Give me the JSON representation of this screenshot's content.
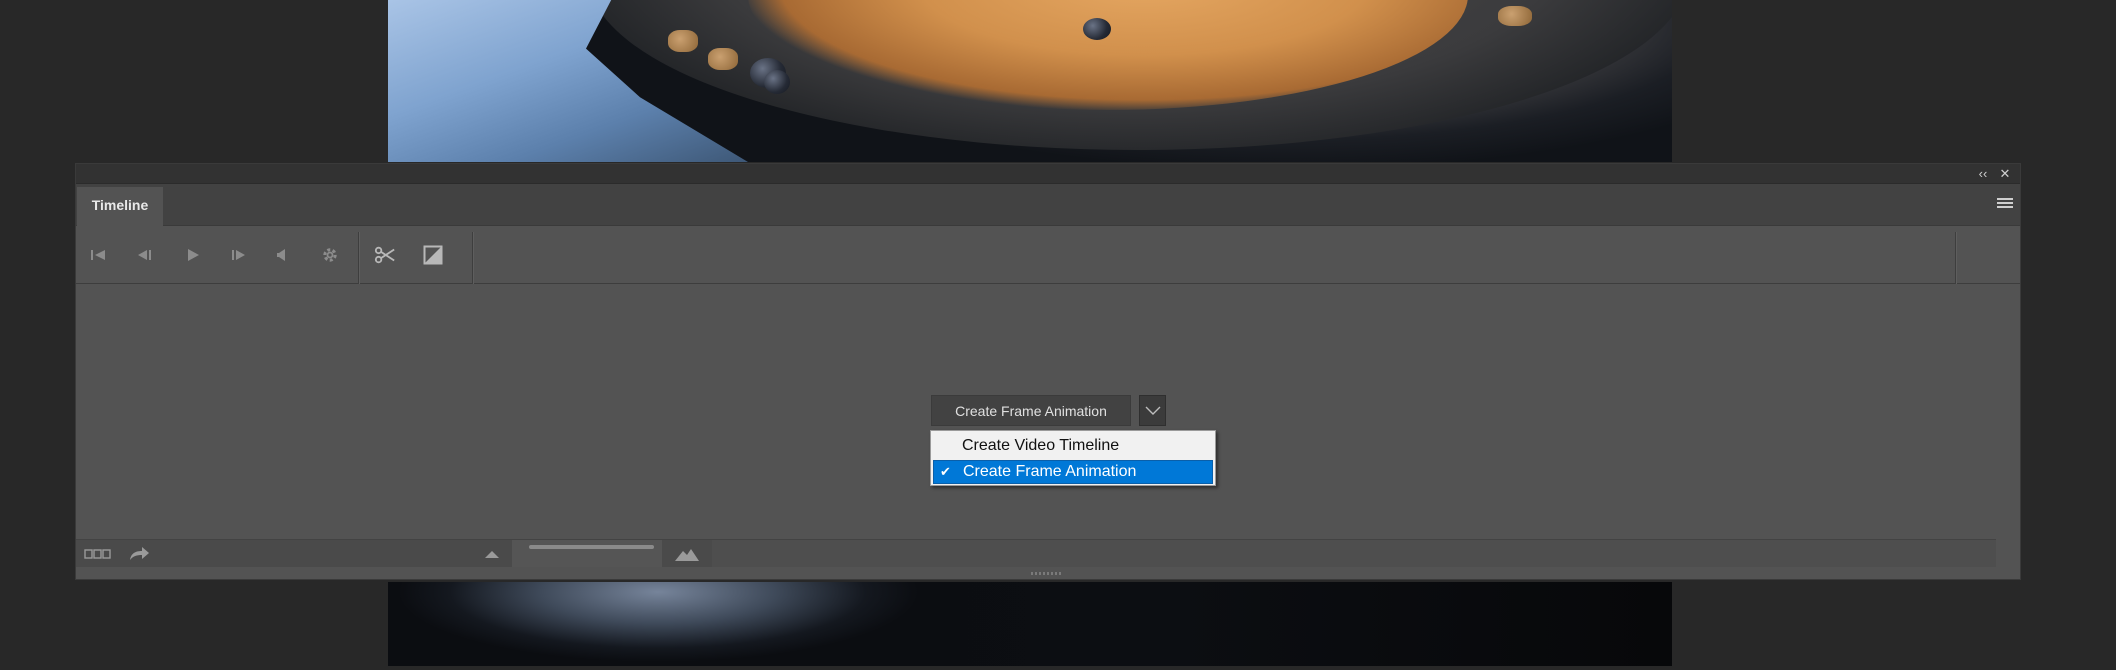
{
  "panel": {
    "title": "Timeline",
    "collapse_icon": "‹‹",
    "close_icon": "✕"
  },
  "toolbar": {
    "icons": [
      "go-to-first-frame-icon",
      "previous-frame-icon",
      "play-icon",
      "next-frame-icon",
      "audio-mute-icon",
      "settings-gear-icon",
      "split-scissors-icon",
      "transition-icon"
    ]
  },
  "create": {
    "button_label": "Create Frame Animation",
    "options": [
      {
        "label": "Create Video Timeline",
        "selected": false
      },
      {
        "label": "Create Frame Animation",
        "selected": true
      }
    ],
    "check_mark": "✔"
  },
  "colors": {
    "panel_bg": "#535353",
    "selection": "#0078d7",
    "menu_bg": "#f1f1f1"
  }
}
